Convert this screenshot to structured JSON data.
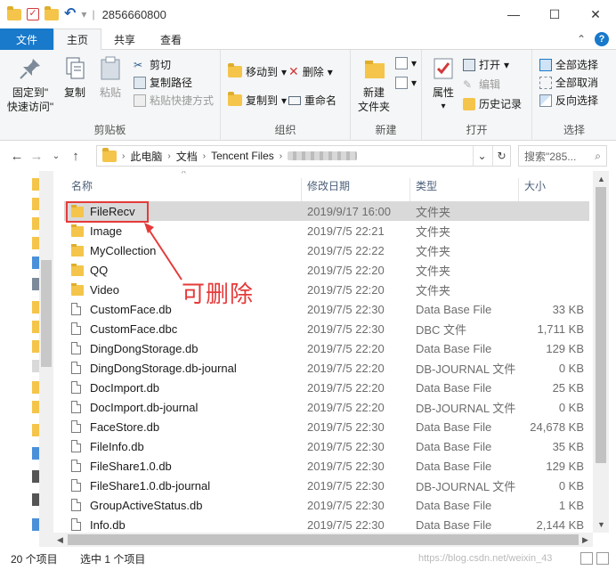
{
  "window": {
    "title": "2856660800",
    "minimize": "—",
    "maximize": "☐",
    "close": "✕"
  },
  "tabs": [
    "文件",
    "主页",
    "共享",
    "查看"
  ],
  "ribbon": {
    "clipboard": {
      "label": "剪贴板",
      "pin": "固定到\"\n快速访问\"",
      "copy": "复制",
      "paste": "粘贴",
      "cut": "剪切",
      "copy_path": "复制路径",
      "paste_shortcut": "粘贴快捷方式"
    },
    "organize": {
      "label": "组织",
      "move_to": "移动到",
      "copy_to": "复制到",
      "delete": "删除",
      "rename": "重命名"
    },
    "new": {
      "label": "新建",
      "new_folder": "新建\n文件夹"
    },
    "open": {
      "label": "打开",
      "properties": "属性",
      "open": "打开",
      "edit": "编辑",
      "history": "历史记录"
    },
    "select": {
      "label": "选择",
      "select_all": "全部选择",
      "select_none": "全部取消",
      "invert": "反向选择"
    }
  },
  "address": {
    "crumbs": [
      "此电脑",
      "文档",
      "Tencent Files"
    ],
    "search_placeholder": "搜索\"285..."
  },
  "columns": {
    "name": "名称",
    "date": "修改日期",
    "type": "类型",
    "size": "大小"
  },
  "files": [
    {
      "name": "FileRecv",
      "date": "2019/9/17 16:00",
      "type": "文件夹",
      "size": "",
      "kind": "folder",
      "selected": true
    },
    {
      "name": "Image",
      "date": "2019/7/5 22:21",
      "type": "文件夹",
      "size": "",
      "kind": "folder"
    },
    {
      "name": "MyCollection",
      "date": "2019/7/5 22:22",
      "type": "文件夹",
      "size": "",
      "kind": "folder"
    },
    {
      "name": "QQ",
      "date": "2019/7/5 22:20",
      "type": "文件夹",
      "size": "",
      "kind": "folder"
    },
    {
      "name": "Video",
      "date": "2019/7/5 22:20",
      "type": "文件夹",
      "size": "",
      "kind": "folder"
    },
    {
      "name": "CustomFace.db",
      "date": "2019/7/5 22:30",
      "type": "Data Base File",
      "size": "33 KB",
      "kind": "file"
    },
    {
      "name": "CustomFace.dbc",
      "date": "2019/7/5 22:30",
      "type": "DBC 文件",
      "size": "1,711 KB",
      "kind": "file"
    },
    {
      "name": "DingDongStorage.db",
      "date": "2019/7/5 22:20",
      "type": "Data Base File",
      "size": "129 KB",
      "kind": "file"
    },
    {
      "name": "DingDongStorage.db-journal",
      "date": "2019/7/5 22:20",
      "type": "DB-JOURNAL 文件",
      "size": "0 KB",
      "kind": "file"
    },
    {
      "name": "DocImport.db",
      "date": "2019/7/5 22:20",
      "type": "Data Base File",
      "size": "25 KB",
      "kind": "file"
    },
    {
      "name": "DocImport.db-journal",
      "date": "2019/7/5 22:20",
      "type": "DB-JOURNAL 文件",
      "size": "0 KB",
      "kind": "file"
    },
    {
      "name": "FaceStore.db",
      "date": "2019/7/5 22:30",
      "type": "Data Base File",
      "size": "24,678 KB",
      "kind": "file"
    },
    {
      "name": "FileInfo.db",
      "date": "2019/7/5 22:30",
      "type": "Data Base File",
      "size": "35 KB",
      "kind": "file"
    },
    {
      "name": "FileShare1.0.db",
      "date": "2019/7/5 22:30",
      "type": "Data Base File",
      "size": "129 KB",
      "kind": "file"
    },
    {
      "name": "FileShare1.0.db-journal",
      "date": "2019/7/5 22:30",
      "type": "DB-JOURNAL 文件",
      "size": "0 KB",
      "kind": "file"
    },
    {
      "name": "GroupActiveStatus.db",
      "date": "2019/7/5 22:30",
      "type": "Data Base File",
      "size": "1 KB",
      "kind": "file"
    },
    {
      "name": "Info.db",
      "date": "2019/7/5 22:30",
      "type": "Data Base File",
      "size": "2,144 KB",
      "kind": "file"
    }
  ],
  "annotation": "可删除",
  "status": {
    "count": "20 个项目",
    "selected": "选中 1 个项目",
    "watermark": "https://blog.csdn.net/weixin_43"
  },
  "colors": {
    "accent": "#1979ca",
    "annotation": "#e53a3a",
    "folder": "#f4c54a"
  }
}
